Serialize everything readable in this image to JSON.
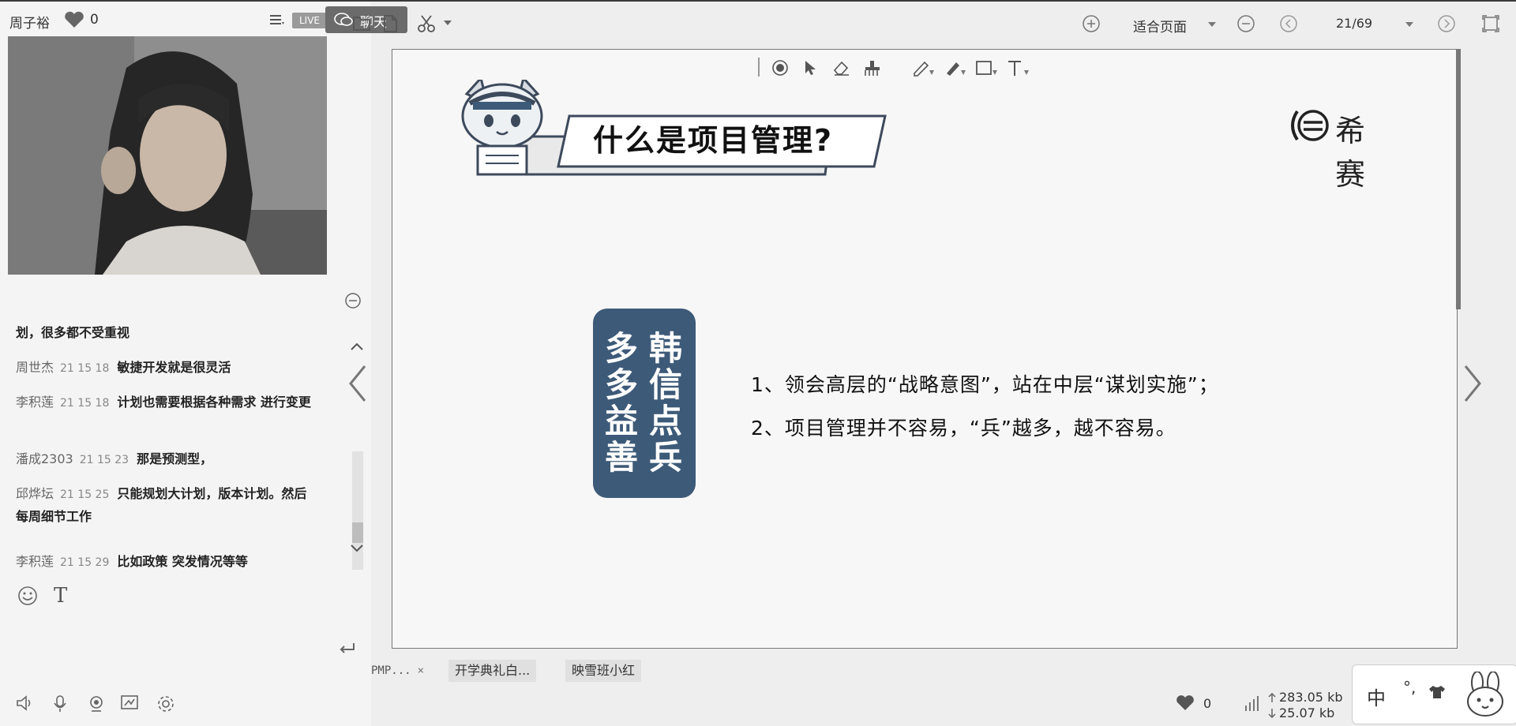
{
  "presenter": {
    "name": "周子裕",
    "likes": "0",
    "live_badge": "LIVE"
  },
  "chat": {
    "messages": [
      {
        "name": "",
        "time": "",
        "text": "划，很多都不受重视"
      },
      {
        "name": "周世杰",
        "time": "21 15 18",
        "text": "敏捷开发就是很灵活"
      },
      {
        "name": "李积莲",
        "time": "21 15 18",
        "text": "计划也需要根据各种需求 进行变更"
      },
      {
        "name": "潘成2303",
        "time": "21 15 23",
        "text": "那是预测型，"
      },
      {
        "name": "邱烨坛",
        "time": "21 15 25",
        "text": "只能规划大计划，版本计划。然后每周细节工作"
      },
      {
        "name": "李积莲",
        "time": "21 15 29",
        "text": "比如政策 突发情况等等"
      }
    ],
    "tab_label": "聊天"
  },
  "toolbar": {
    "fit_label": "适合页面",
    "page": "21/69"
  },
  "slide": {
    "title": "什么是项目管理?",
    "brand": "希赛",
    "idiom_right": "韩信点兵",
    "idiom_left": "多多益善",
    "point_1": "1、领会高层的“战略意图”，站在中层“谋划实施”；",
    "point_2": "2、项目管理并不容易，“兵”越多，越不容易。"
  },
  "doc_tabs": [
    {
      "label": "PMP..."
    },
    {
      "label": "开学典礼白..."
    },
    {
      "label": "映雪班小红"
    }
  ],
  "status": {
    "likes": "0",
    "upload": "283.05 kb",
    "download": "25.07 kb"
  },
  "ime": {
    "lang": "中",
    "punct": "°,"
  },
  "colors": {
    "slide_card": "#3d5a78",
    "live_badge": "#9a9a9a",
    "chat_button": "#6b6b6b"
  }
}
